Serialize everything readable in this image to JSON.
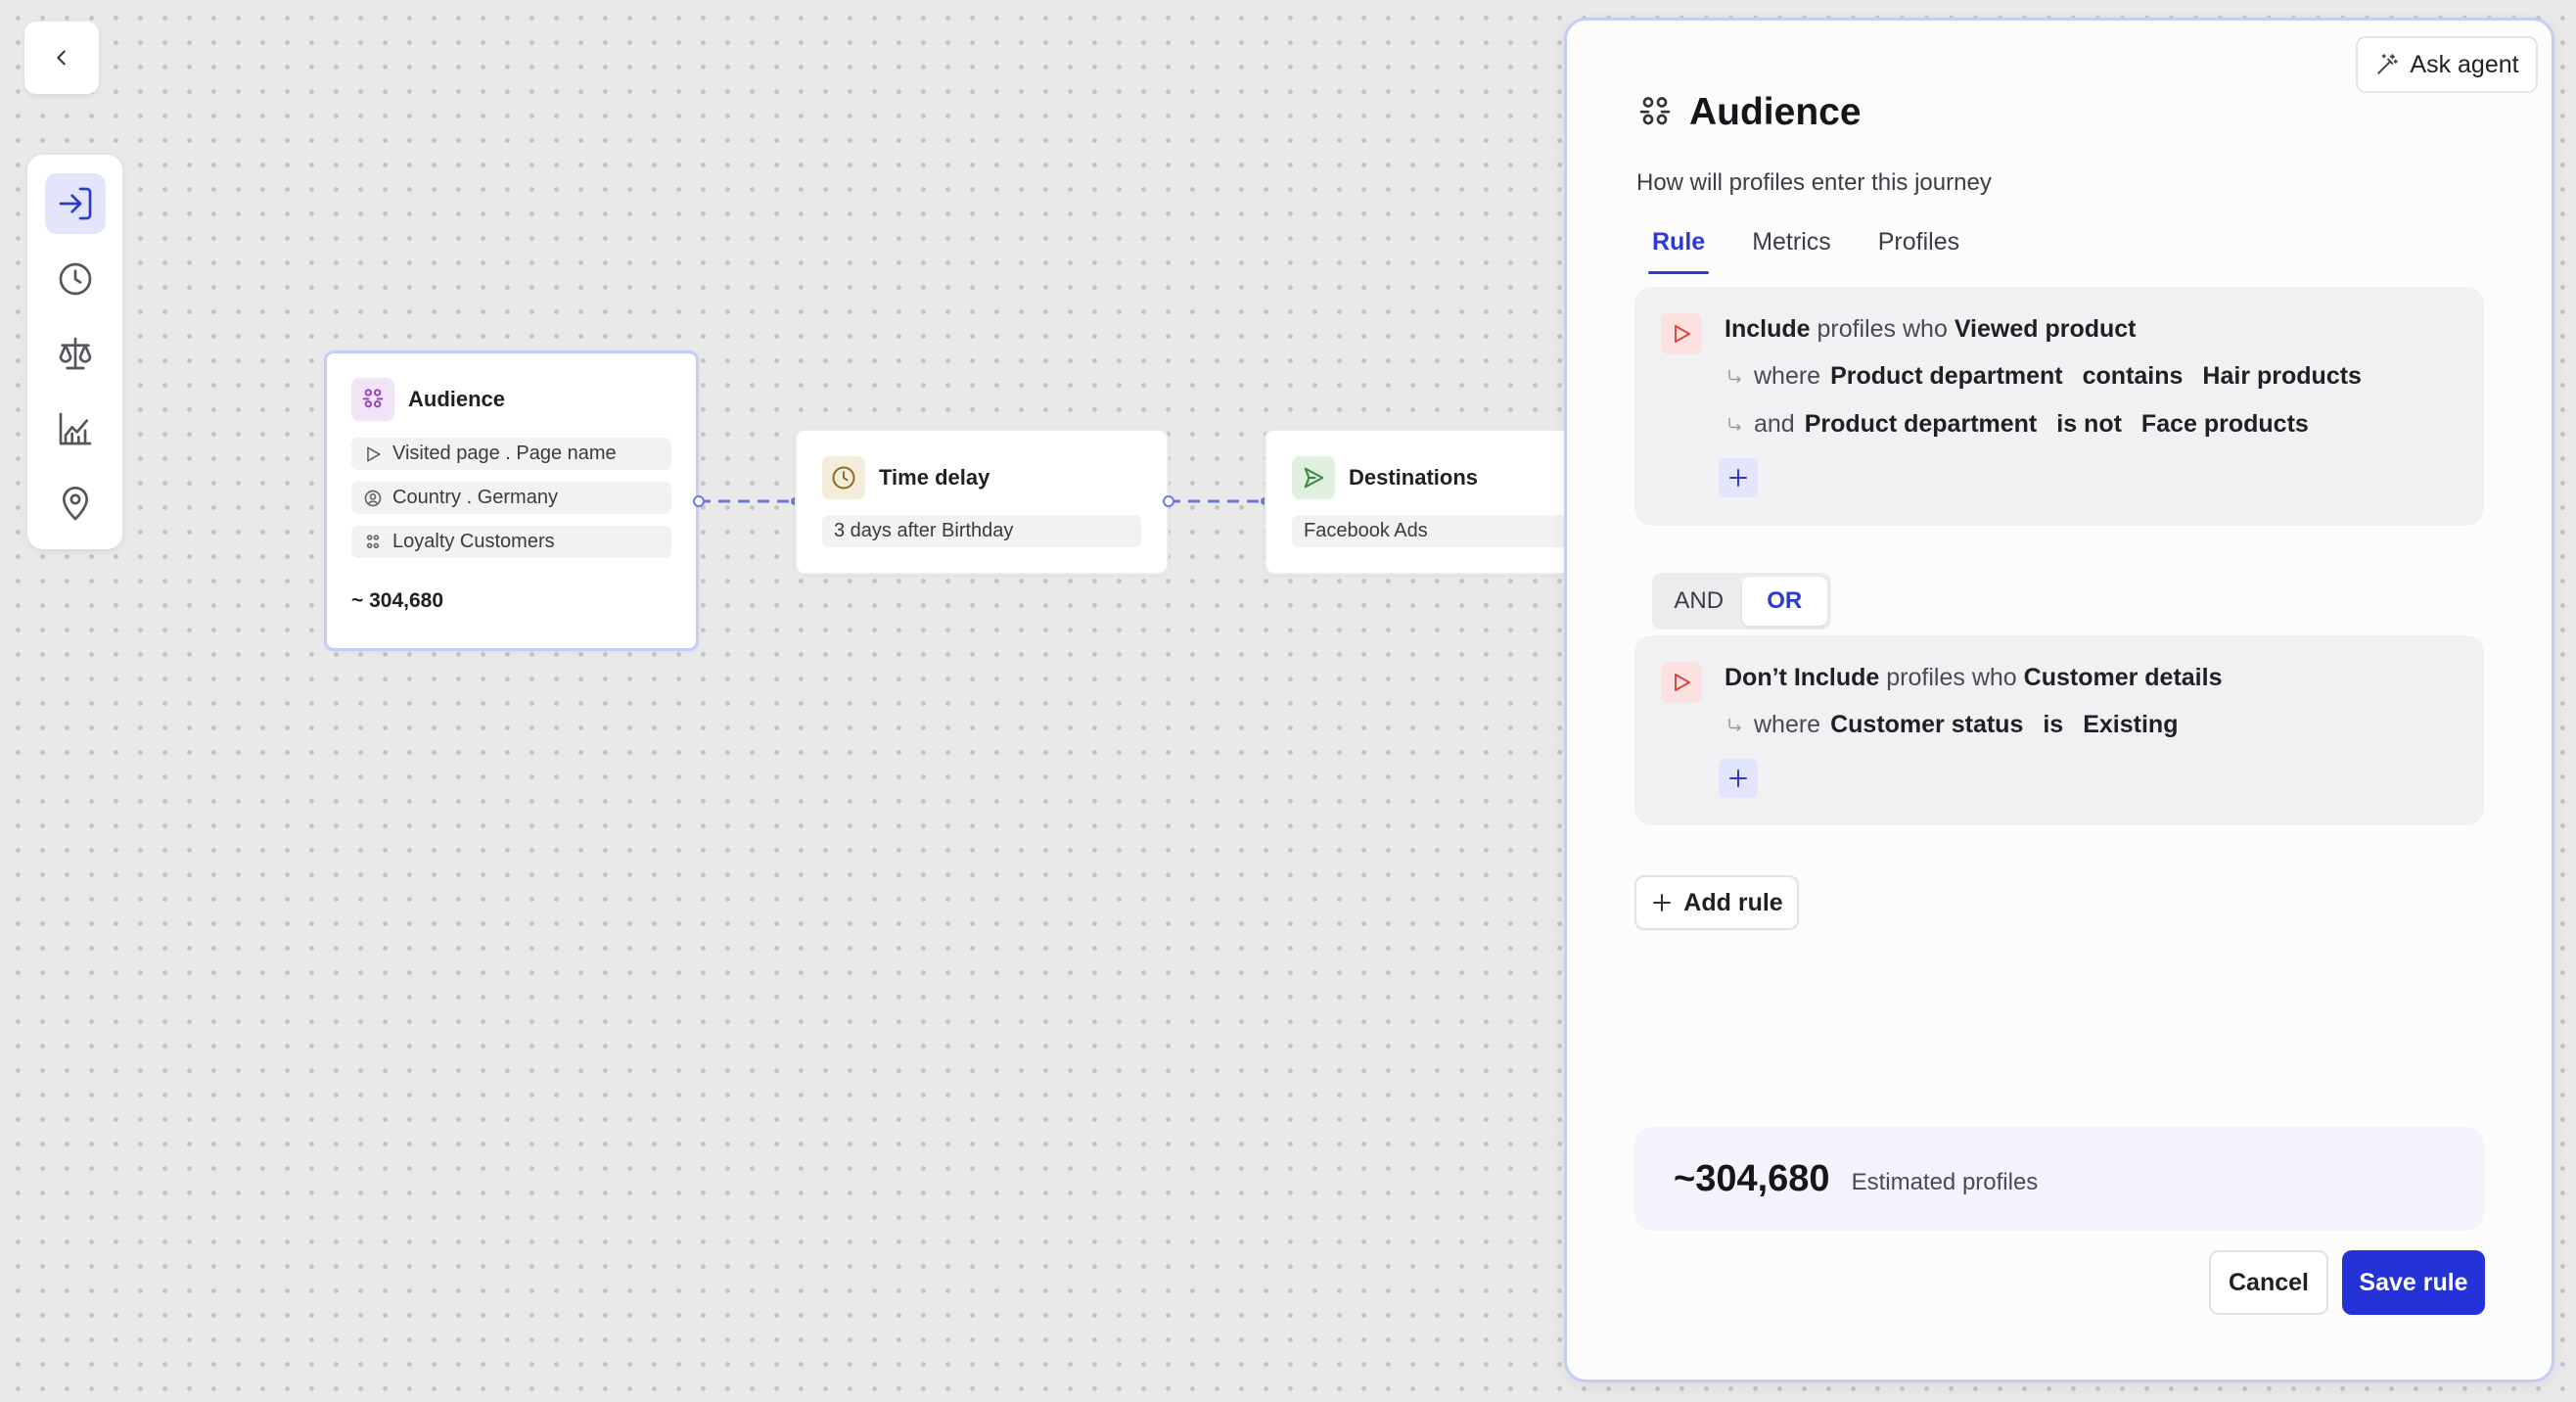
{
  "canvas": {
    "nodes": {
      "audience": {
        "title": "Audience",
        "chips": [
          "Visited page . Page name",
          "Country . Germany",
          "Loyalty Customers"
        ],
        "count": "~ 304,680"
      },
      "time_delay": {
        "title": "Time delay",
        "chip": "3 days after Birthday"
      },
      "destinations": {
        "title": "Destinations",
        "chip": "Facebook Ads"
      }
    }
  },
  "panel": {
    "ask_agent_label": "Ask agent",
    "title": "Audience",
    "subtitle": "How will profiles enter this journey",
    "tabs": [
      "Rule",
      "Metrics",
      "Profiles"
    ],
    "active_tab": "Rule",
    "rule1": {
      "include": "Include",
      "profiles_who": "profiles who",
      "event": "Viewed product",
      "cond1": {
        "prefix": "where",
        "field": "Product department",
        "op": "contains",
        "value": "Hair products"
      },
      "cond2": {
        "prefix": "and",
        "field": "Product department",
        "op": "is not",
        "value": "Face products"
      }
    },
    "logic": {
      "and": "AND",
      "or": "OR",
      "selected": "OR"
    },
    "rule2": {
      "include": "Don’t Include",
      "profiles_who": "profiles who",
      "event": "Customer details",
      "cond1": {
        "prefix": "where",
        "field": "Customer status",
        "op": "is",
        "value": "Existing"
      }
    },
    "add_rule_label": "Add rule",
    "estimate": {
      "value": "~304,680",
      "label": "Estimated profiles"
    },
    "cancel_label": "Cancel",
    "save_label": "Save rule"
  },
  "colors": {
    "accent": "#2432d8",
    "audience_icon_bg": "#f1e4f7",
    "time_delay_icon_bg": "#f3ecd9",
    "destinations_icon_bg": "#dff0df",
    "rule_icon_bg": "#fbe2e0"
  },
  "icons": {
    "toolbar": [
      "sign-in-icon",
      "clock-icon",
      "scale-icon",
      "chart-line-icon",
      "map-pin-icon"
    ]
  }
}
